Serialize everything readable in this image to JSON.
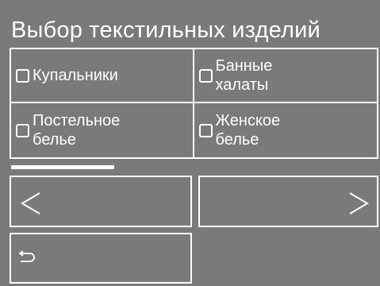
{
  "header": {
    "title": "Выбор текстильных изделий"
  },
  "options": [
    {
      "label": "Купальники",
      "checked": false
    },
    {
      "label": "Банные\nхалаты",
      "checked": false
    },
    {
      "label": "Постельное\nбелье",
      "checked": false
    },
    {
      "label": "Женское\nбелье",
      "checked": false
    }
  ],
  "page_progress": 0.28,
  "nav": {
    "prev_icon": "chevron-left-icon",
    "next_icon": "chevron-right-icon",
    "back_icon": "return-arrow-icon"
  },
  "colors": {
    "background": "#7a7a7c",
    "foreground": "#ffffff"
  }
}
